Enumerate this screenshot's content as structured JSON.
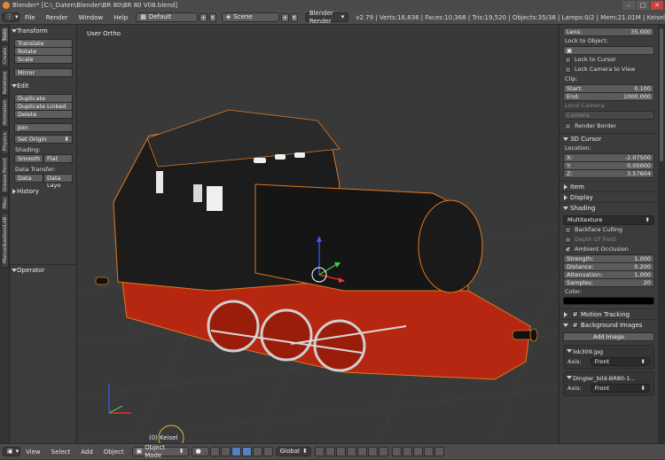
{
  "window": {
    "title": "Blender* [C:\\_Daten\\Blender\\BR 80\\BR 80 V08.blend]",
    "buttons": [
      "–",
      "□",
      "✕"
    ]
  },
  "top_header": {
    "menus": [
      "File",
      "Render",
      "Window",
      "Help"
    ],
    "screen_layout": "Default",
    "scene": "Scene",
    "render_engine": "Blender Render",
    "stats": "v2.79 | Verts:16,836 | Faces:10,368 | Tris:19,520 | Objects:35/38 | Lamps:0/2 | Mem:21.01M | Keisel"
  },
  "tool_tabs": [
    "Tools",
    "Create",
    "Relations",
    "Animation",
    "Physics",
    "Grease Pencil",
    "Misc",
    "ManuelbastioniLAB"
  ],
  "tool_shelf": {
    "transform": {
      "header": "Transform",
      "buttons": [
        "Translate",
        "Rotate",
        "Scale",
        "Mirror"
      ]
    },
    "edit": {
      "header": "Edit",
      "buttons": [
        "Duplicate",
        "Duplicate Linked",
        "Delete",
        "Join"
      ],
      "set_origin": "Set Origin",
      "shading_label": "Shading:",
      "shading_buttons": [
        "Smooth",
        "Flat"
      ],
      "data_transfer_label": "Data Transfer:",
      "data_transfer_buttons": [
        "Data",
        "Data Layo"
      ]
    },
    "history": "History",
    "operator": "Operator"
  },
  "viewport": {
    "view_label": "User Ortho",
    "object_label": "(0) Keisel"
  },
  "properties": {
    "lens": {
      "label": "Lens:",
      "value": "35.000"
    },
    "lock_to_object": "Lock to Object:",
    "lock_to_cursor": "Lock to Cursor",
    "lock_camera_to_view": "Lock Camera to View",
    "clip": {
      "label": "Clip:",
      "start_label": "Start:",
      "start": "0.100",
      "end_label": "End:",
      "end": "1000.000"
    },
    "local_camera": "Local Camera",
    "camera_placeholder": "Camera",
    "render_border": "Render Border",
    "cursor": {
      "header": "3D Cursor",
      "location_label": "Location:",
      "x_label": "X:",
      "x": "-2.07500",
      "y_label": "Y:",
      "y": "0.00000",
      "z_label": "Z:",
      "z": "3.57604"
    },
    "item": "Item",
    "display": "Display",
    "shading": {
      "header": "Shading",
      "mode": "Multitexture",
      "backface_culling": "Backface Culling",
      "depth_of_field": "Depth Of Field",
      "ambient_occlusion": "Ambient Occlusion",
      "strength_label": "Strength:",
      "strength": "1.000",
      "distance_label": "Distance:",
      "distance": "0.200",
      "attenuation_label": "Attenuation:",
      "attenuation": "1.000",
      "samples_label": "Samples:",
      "samples": "20",
      "color_label": "Color:"
    },
    "motion_tracking": "Motion Tracking",
    "background_images": {
      "header": "Background Images",
      "add_button": "Add Image",
      "items": [
        {
          "name": "lok309.jpg",
          "axis_label": "Axis:",
          "axis": "Front"
        },
        {
          "name": "Dingler_bild-BR80-1...",
          "axis_label": "Axis:",
          "axis": "Front"
        }
      ]
    }
  },
  "bottom_bar": {
    "menus": [
      "View",
      "Select",
      "Add",
      "Object"
    ],
    "mode": "Object Mode",
    "orientation": "Global"
  },
  "colors": {
    "accent_orange": "#e08a2c",
    "loco_body": "#1c1c1c",
    "loco_red": "#b8250f",
    "selection_outline": "#e07a20"
  }
}
